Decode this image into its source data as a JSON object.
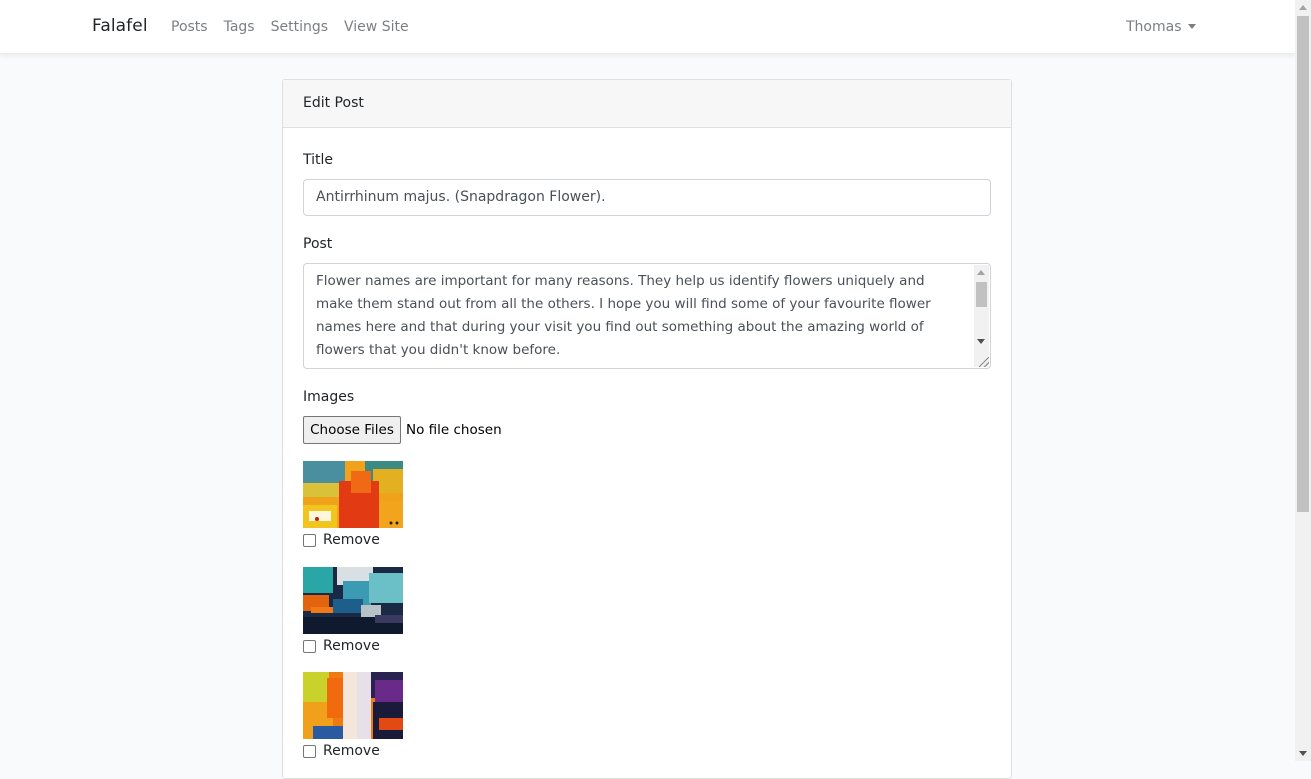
{
  "navbar": {
    "brand": "Falafel",
    "links": [
      {
        "label": "Posts"
      },
      {
        "label": "Tags"
      },
      {
        "label": "Settings"
      },
      {
        "label": "View Site"
      }
    ],
    "user": "Thomas"
  },
  "card": {
    "header": "Edit Post",
    "title_label": "Title",
    "title_value": "Antirrhinum majus. (Snapdragon Flower).",
    "post_label": "Post",
    "post_value": "Flower names are important for many reasons. They help us identify flowers uniquely and make them stand out from all the others. I hope you will find some of your favourite flower names here and that during your visit you find out something about the amazing world of flowers that you didn't know before.",
    "images_label": "Images",
    "choose_files": "Choose Files",
    "no_file": "No file chosen",
    "images": [
      {
        "remove_label": "Remove"
      },
      {
        "remove_label": "Remove"
      },
      {
        "remove_label": "Remove"
      }
    ]
  },
  "colors": {
    "background": "#f8fafc",
    "nav_link": "#7b7f84",
    "card_header": "#f7f7f7"
  },
  "icons": {
    "user_menu": "caret-down-icon",
    "checkbox": "checkbox-icon"
  }
}
